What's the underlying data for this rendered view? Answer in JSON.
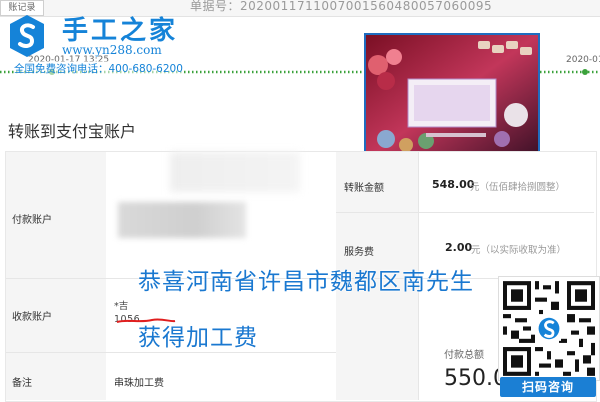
{
  "top_bar": {
    "tab_label": "账记录",
    "order_number": "单据号：2020011711007001560480057060095"
  },
  "progress": {
    "start_date": "2020-01-17 13:25",
    "end_date": "2020-01"
  },
  "brand": {
    "name": "手工之家",
    "url": "www.yn288.com",
    "hotline": "全国免费咨询电话：400-680-6200"
  },
  "page": {
    "title": "转账到支付宝账户"
  },
  "transfer": {
    "payer_label": "付款账户",
    "payee_label": "收款账户",
    "payee_name_prefix": "*吉",
    "payee_account": "1056",
    "memo_label": "备注",
    "memo_value": "串珠加工费",
    "amount_label": "转账金额",
    "amount_value": "548.00",
    "amount_unit": "元（伍佰肆拾捌圆整）",
    "fee_label": "服务费",
    "fee_value": "2.00",
    "fee_unit": "元（以实际收取为准）",
    "total_label": "付款总额",
    "total_value": "550.0"
  },
  "overlay": {
    "line1": "恭喜河南省许昌市魏都区南先生",
    "line2": "获得加工费"
  },
  "qr": {
    "button_label": "扫码咨询"
  },
  "colors": {
    "brand_blue": "#1583d8",
    "overlay_blue": "#1a78d0",
    "progress_green": "#3aa13a",
    "qr_button": "#1b7fd4"
  }
}
